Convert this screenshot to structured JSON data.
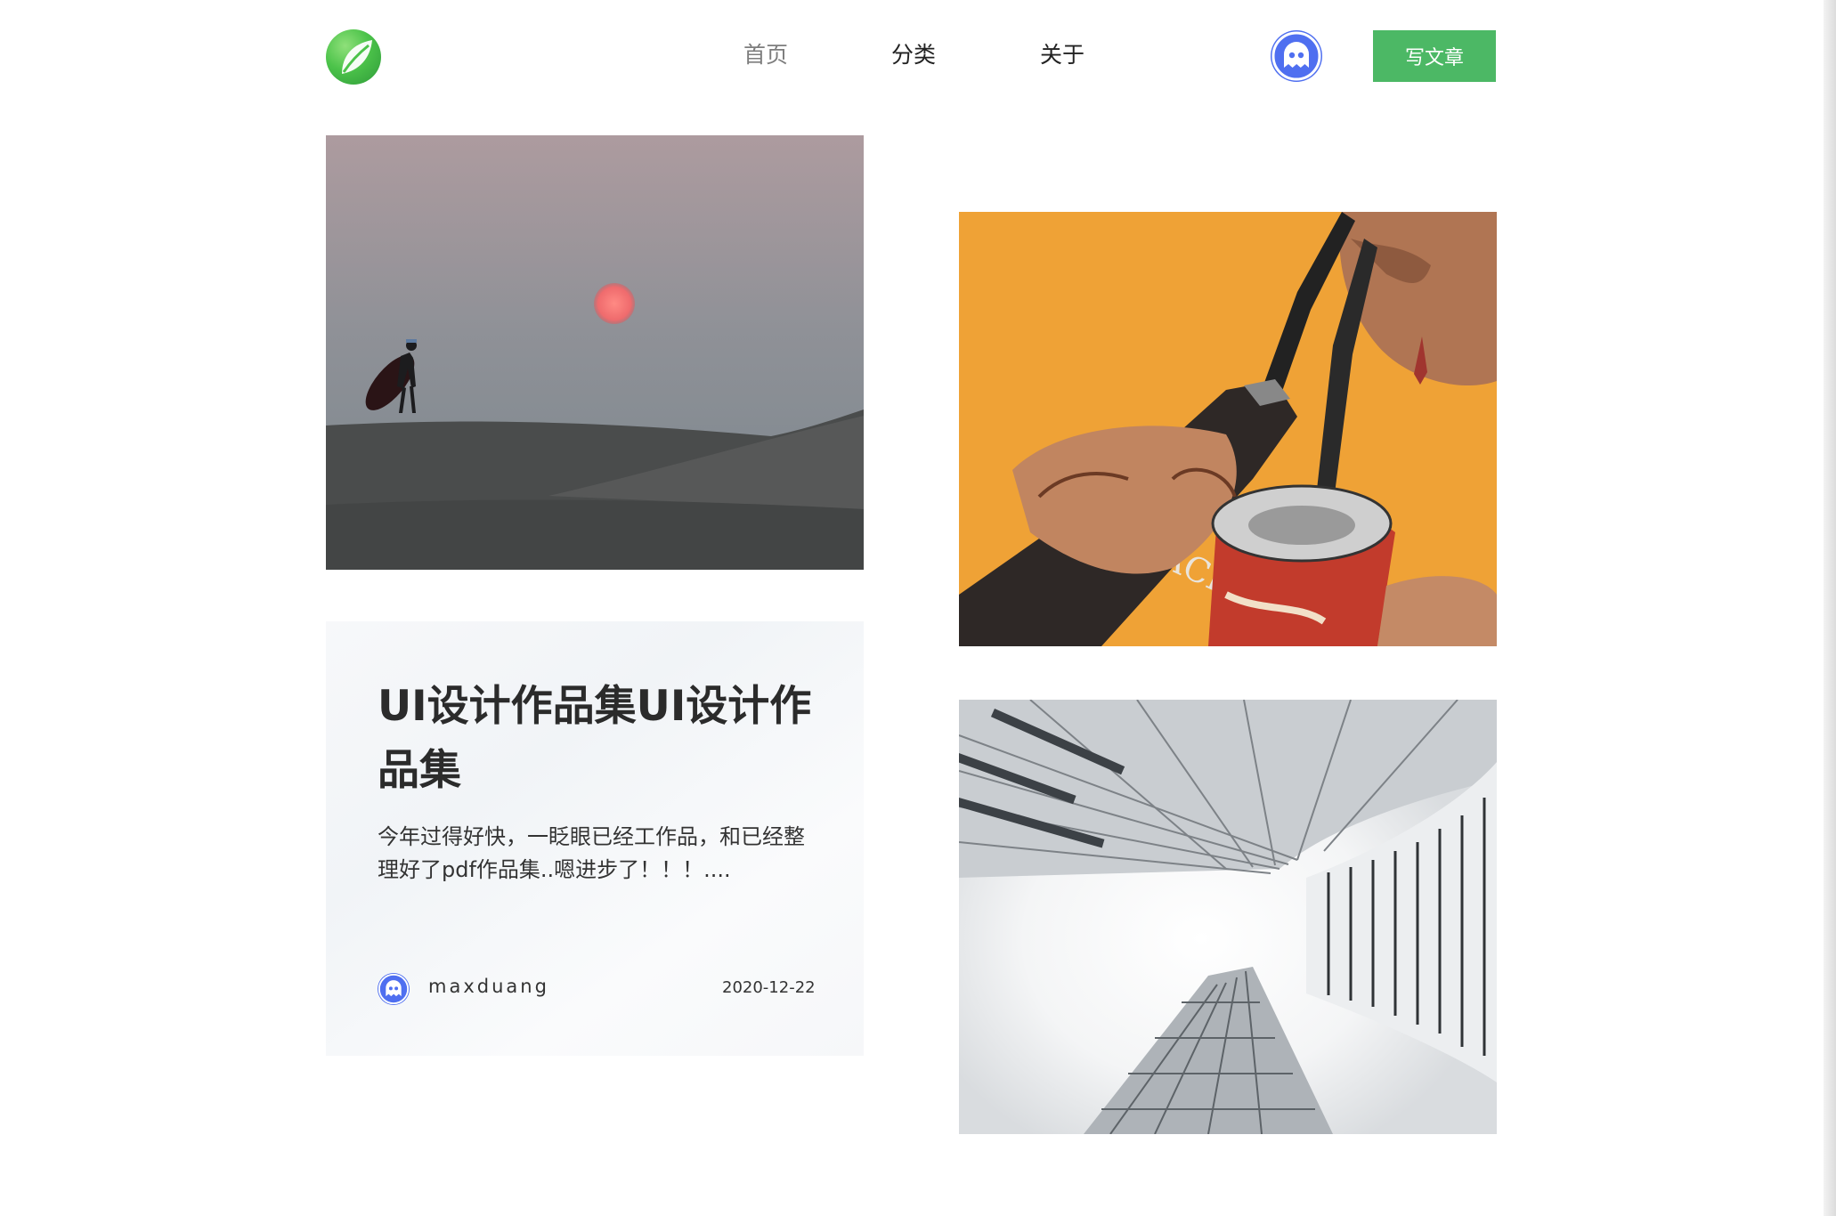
{
  "nav": {
    "items": [
      {
        "label": "首页",
        "active": true
      },
      {
        "label": "分类",
        "active": false
      },
      {
        "label": "关于",
        "active": false
      }
    ]
  },
  "header": {
    "logo_icon": "leaf-logo-icon",
    "avatar_icon": "ghost-avatar-icon",
    "write_button_label": "写文章",
    "write_button_color": "#4cb865",
    "avatar_color": "#4f6ff0"
  },
  "article": {
    "title": "UI设计作品集UI设计作品集",
    "excerpt": "今年过得好快，一眨眼已经工作品，和已经整理好了pdf作品集..嗯进步了！！！....",
    "author": "maxduang",
    "date": "2020-12-22"
  },
  "images": [
    {
      "subject": "desert-surfer-sunset-photo"
    },
    {
      "subject": "mural-bottle-can-photo"
    },
    {
      "subject": "building-atrium-photo"
    }
  ]
}
